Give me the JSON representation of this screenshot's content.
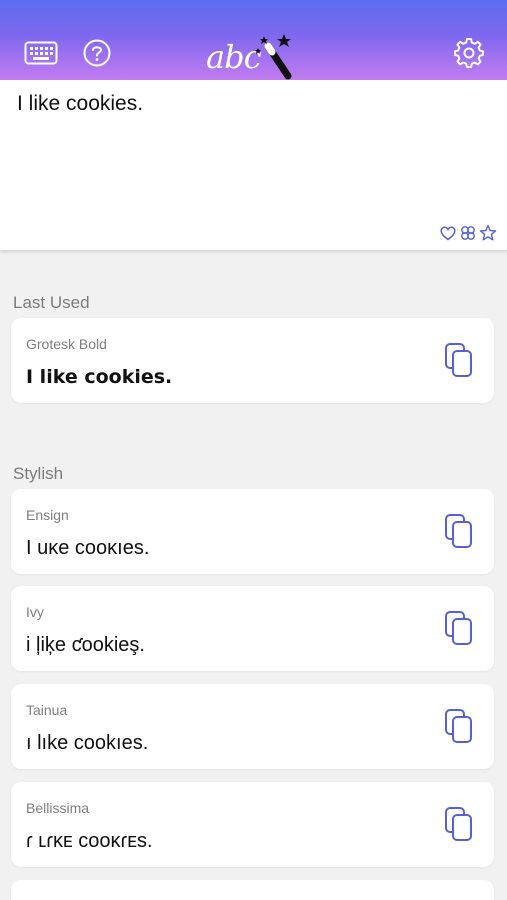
{
  "header": {
    "logo_text": "abc",
    "icons": {
      "keyboard": "keyboard-icon",
      "help": "help-icon",
      "settings": "gear-icon",
      "logo_wand": "magic-wand-icon"
    },
    "accent": "#5a6ef0"
  },
  "input": {
    "text": "I like cookies.",
    "icons": [
      "heart-icon",
      "clover-icon",
      "star-icon"
    ]
  },
  "sections": {
    "last_used": "Last Used",
    "stylish": "Stylish"
  },
  "last_used": [
    {
      "name": "Grotesk Bold",
      "sample": "I like cookies."
    }
  ],
  "stylish": [
    {
      "name": "Ensign",
      "sample": "I uĸe cooĸıes."
    },
    {
      "name": "Ivy",
      "sample": "i ļiķe ƈookieş."
    },
    {
      "name": "Tainua",
      "sample": "ı lıke cookıes."
    },
    {
      "name": "Bellissima",
      "sample": "ɾ ʟɾĸᴇ ᴄᴏᴏĸɾᴇs."
    }
  ],
  "copy_icon": "copy-icon"
}
